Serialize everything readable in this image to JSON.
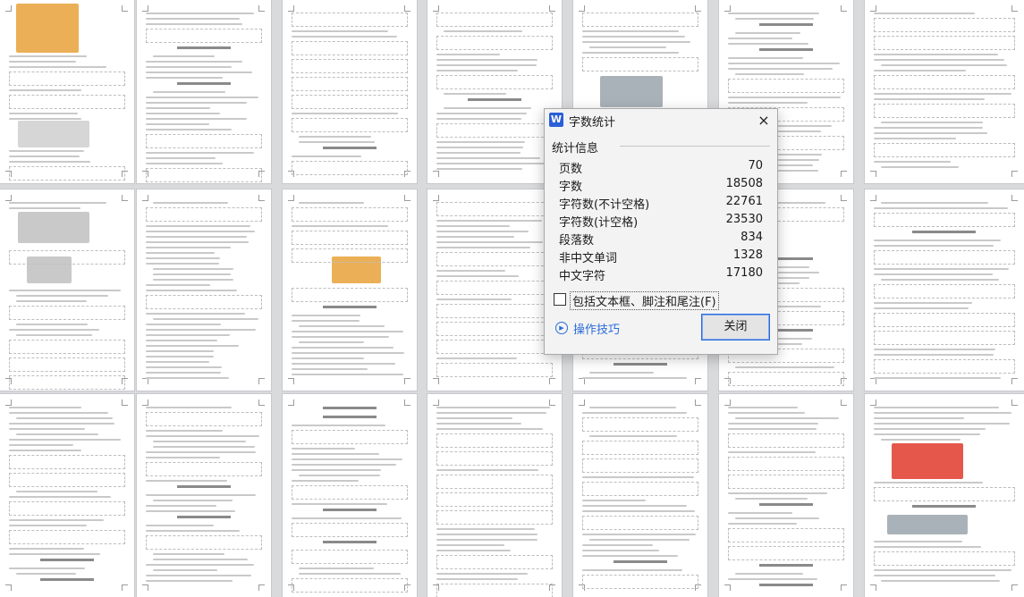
{
  "dialog": {
    "app_icon_letter": "W",
    "title": "字数统计",
    "close_icon": "×",
    "section_label": "统计信息",
    "stats": [
      {
        "label": "页数",
        "value": "70"
      },
      {
        "label": "字数",
        "value": "18508"
      },
      {
        "label": "字符数(不计空格)",
        "value": "22761"
      },
      {
        "label": "字符数(计空格)",
        "value": "23530"
      },
      {
        "label": "段落数",
        "value": "834"
      },
      {
        "label": "非中文单词",
        "value": "1328"
      },
      {
        "label": "中文字符",
        "value": "17180"
      }
    ],
    "checkbox_label": "包括文本框、脚注和尾注(F)",
    "checkbox_checked": false,
    "tips_label": "操作技巧",
    "close_button_label": "关闭"
  },
  "colors": {
    "background": "#d9dadc",
    "accent": "#2b6cd9",
    "app_icon": "#2b5fd9",
    "red_part": "#e03a2a",
    "orange_frame": "#e8a23a"
  },
  "icons": [
    "wps-writer-icon",
    "close-icon",
    "checkbox-icon",
    "play-circle-icon"
  ]
}
